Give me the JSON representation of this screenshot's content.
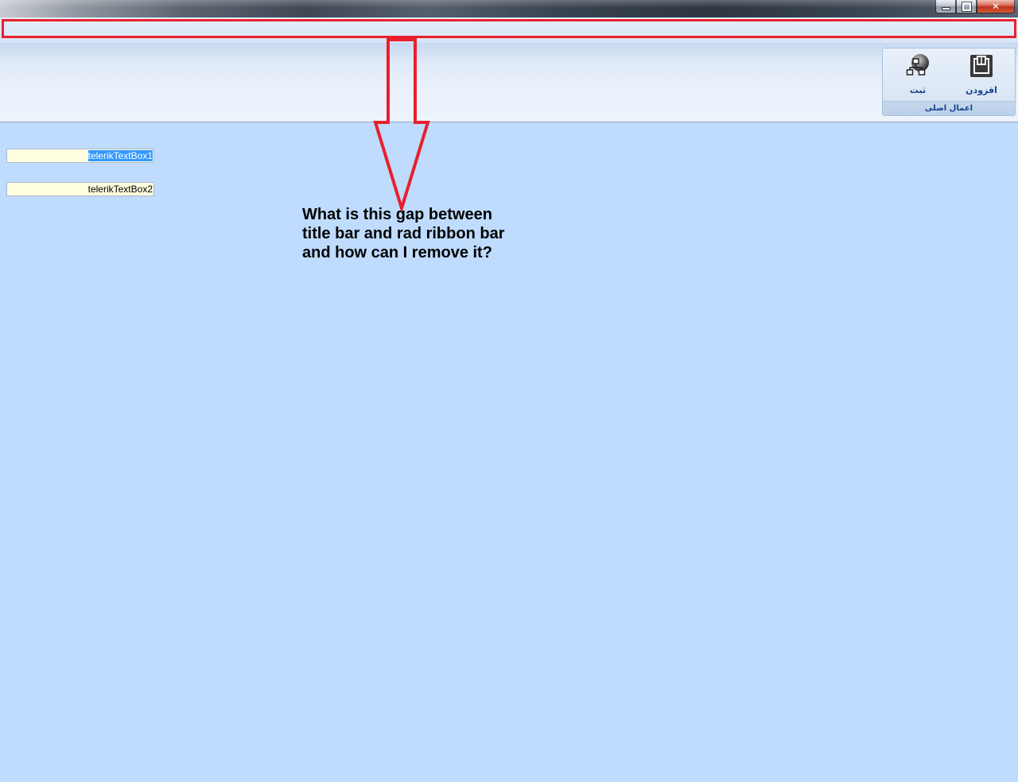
{
  "window": {
    "controls": {
      "minimize_icon": "minimize-icon",
      "maximize_icon": "restore-icon",
      "close_label": "✕"
    }
  },
  "ribbon": {
    "group": {
      "caption": "اعمال اصلی",
      "buttons": [
        {
          "label": "ثبت",
          "icon": "sitemap-globe-icon"
        },
        {
          "label": "افزودن",
          "icon": "add-frame-icon"
        }
      ]
    }
  },
  "form": {
    "textbox1": {
      "value": "telerikTextBox1",
      "selected": true
    },
    "textbox2": {
      "value": "telerikTextBox2",
      "selected": false
    }
  },
  "annotation": {
    "lines": [
      "What is this gap between",
      "title bar and rad ribbon bar",
      "and how can I remove it?"
    ],
    "color": "#e8202e"
  },
  "colors": {
    "form_background": "#bfdbfd",
    "textbox_background": "#fffedf",
    "selection": "#3399ff",
    "ribbon_text": "#15428b"
  }
}
